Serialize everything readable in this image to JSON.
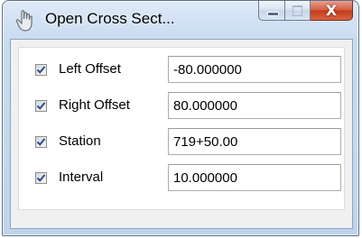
{
  "window": {
    "title": "Open Cross Sect...",
    "close_glyph": "X"
  },
  "icons": {
    "app": "hand-pointer-icon",
    "minimize": "minimize-icon",
    "maximize": "maximize-icon",
    "close": "close-icon",
    "check": "checkmark-icon"
  },
  "rows": [
    {
      "label": "Left Offset",
      "value": "-80.000000",
      "checked": true
    },
    {
      "label": "Right Offset",
      "value": "80.000000",
      "checked": true
    },
    {
      "label": "Station",
      "value": "719+50.00",
      "checked": true
    },
    {
      "label": "Interval",
      "value": "10.000000",
      "checked": true
    }
  ],
  "colors": {
    "check": "#2b4f8c",
    "close_button": "#c9452a"
  }
}
